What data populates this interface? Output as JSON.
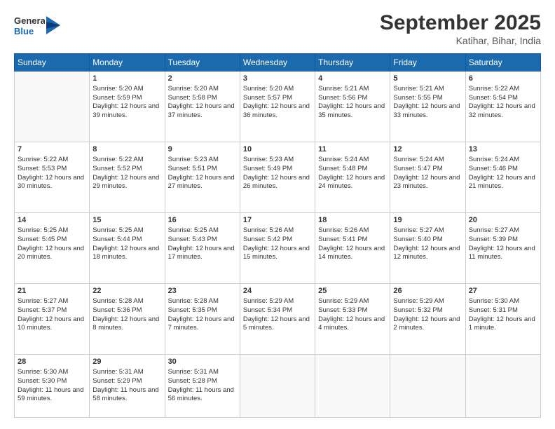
{
  "logo": {
    "line1": "General",
    "line2": "Blue"
  },
  "title": "September 2025",
  "location": "Katihar, Bihar, India",
  "weekdays": [
    "Sunday",
    "Monday",
    "Tuesday",
    "Wednesday",
    "Thursday",
    "Friday",
    "Saturday"
  ],
  "weeks": [
    [
      {
        "day": null,
        "content": null
      },
      {
        "day": "1",
        "sunrise": "5:20 AM",
        "sunset": "5:59 PM",
        "daylight": "12 hours and 39 minutes."
      },
      {
        "day": "2",
        "sunrise": "5:20 AM",
        "sunset": "5:58 PM",
        "daylight": "12 hours and 37 minutes."
      },
      {
        "day": "3",
        "sunrise": "5:20 AM",
        "sunset": "5:57 PM",
        "daylight": "12 hours and 36 minutes."
      },
      {
        "day": "4",
        "sunrise": "5:21 AM",
        "sunset": "5:56 PM",
        "daylight": "12 hours and 35 minutes."
      },
      {
        "day": "5",
        "sunrise": "5:21 AM",
        "sunset": "5:55 PM",
        "daylight": "12 hours and 33 minutes."
      },
      {
        "day": "6",
        "sunrise": "5:22 AM",
        "sunset": "5:54 PM",
        "daylight": "12 hours and 32 minutes."
      }
    ],
    [
      {
        "day": "7",
        "sunrise": "5:22 AM",
        "sunset": "5:53 PM",
        "daylight": "12 hours and 30 minutes."
      },
      {
        "day": "8",
        "sunrise": "5:22 AM",
        "sunset": "5:52 PM",
        "daylight": "12 hours and 29 minutes."
      },
      {
        "day": "9",
        "sunrise": "5:23 AM",
        "sunset": "5:51 PM",
        "daylight": "12 hours and 27 minutes."
      },
      {
        "day": "10",
        "sunrise": "5:23 AM",
        "sunset": "5:49 PM",
        "daylight": "12 hours and 26 minutes."
      },
      {
        "day": "11",
        "sunrise": "5:24 AM",
        "sunset": "5:48 PM",
        "daylight": "12 hours and 24 minutes."
      },
      {
        "day": "12",
        "sunrise": "5:24 AM",
        "sunset": "5:47 PM",
        "daylight": "12 hours and 23 minutes."
      },
      {
        "day": "13",
        "sunrise": "5:24 AM",
        "sunset": "5:46 PM",
        "daylight": "12 hours and 21 minutes."
      }
    ],
    [
      {
        "day": "14",
        "sunrise": "5:25 AM",
        "sunset": "5:45 PM",
        "daylight": "12 hours and 20 minutes."
      },
      {
        "day": "15",
        "sunrise": "5:25 AM",
        "sunset": "5:44 PM",
        "daylight": "12 hours and 18 minutes."
      },
      {
        "day": "16",
        "sunrise": "5:25 AM",
        "sunset": "5:43 PM",
        "daylight": "12 hours and 17 minutes."
      },
      {
        "day": "17",
        "sunrise": "5:26 AM",
        "sunset": "5:42 PM",
        "daylight": "12 hours and 15 minutes."
      },
      {
        "day": "18",
        "sunrise": "5:26 AM",
        "sunset": "5:41 PM",
        "daylight": "12 hours and 14 minutes."
      },
      {
        "day": "19",
        "sunrise": "5:27 AM",
        "sunset": "5:40 PM",
        "daylight": "12 hours and 12 minutes."
      },
      {
        "day": "20",
        "sunrise": "5:27 AM",
        "sunset": "5:39 PM",
        "daylight": "12 hours and 11 minutes."
      }
    ],
    [
      {
        "day": "21",
        "sunrise": "5:27 AM",
        "sunset": "5:37 PM",
        "daylight": "12 hours and 10 minutes."
      },
      {
        "day": "22",
        "sunrise": "5:28 AM",
        "sunset": "5:36 PM",
        "daylight": "12 hours and 8 minutes."
      },
      {
        "day": "23",
        "sunrise": "5:28 AM",
        "sunset": "5:35 PM",
        "daylight": "12 hours and 7 minutes."
      },
      {
        "day": "24",
        "sunrise": "5:29 AM",
        "sunset": "5:34 PM",
        "daylight": "12 hours and 5 minutes."
      },
      {
        "day": "25",
        "sunrise": "5:29 AM",
        "sunset": "5:33 PM",
        "daylight": "12 hours and 4 minutes."
      },
      {
        "day": "26",
        "sunrise": "5:29 AM",
        "sunset": "5:32 PM",
        "daylight": "12 hours and 2 minutes."
      },
      {
        "day": "27",
        "sunrise": "5:30 AM",
        "sunset": "5:31 PM",
        "daylight": "12 hours and 1 minute."
      }
    ],
    [
      {
        "day": "28",
        "sunrise": "5:30 AM",
        "sunset": "5:30 PM",
        "daylight": "11 hours and 59 minutes."
      },
      {
        "day": "29",
        "sunrise": "5:31 AM",
        "sunset": "5:29 PM",
        "daylight": "11 hours and 58 minutes."
      },
      {
        "day": "30",
        "sunrise": "5:31 AM",
        "sunset": "5:28 PM",
        "daylight": "11 hours and 56 minutes."
      },
      {
        "day": null,
        "content": null
      },
      {
        "day": null,
        "content": null
      },
      {
        "day": null,
        "content": null
      },
      {
        "day": null,
        "content": null
      }
    ]
  ]
}
